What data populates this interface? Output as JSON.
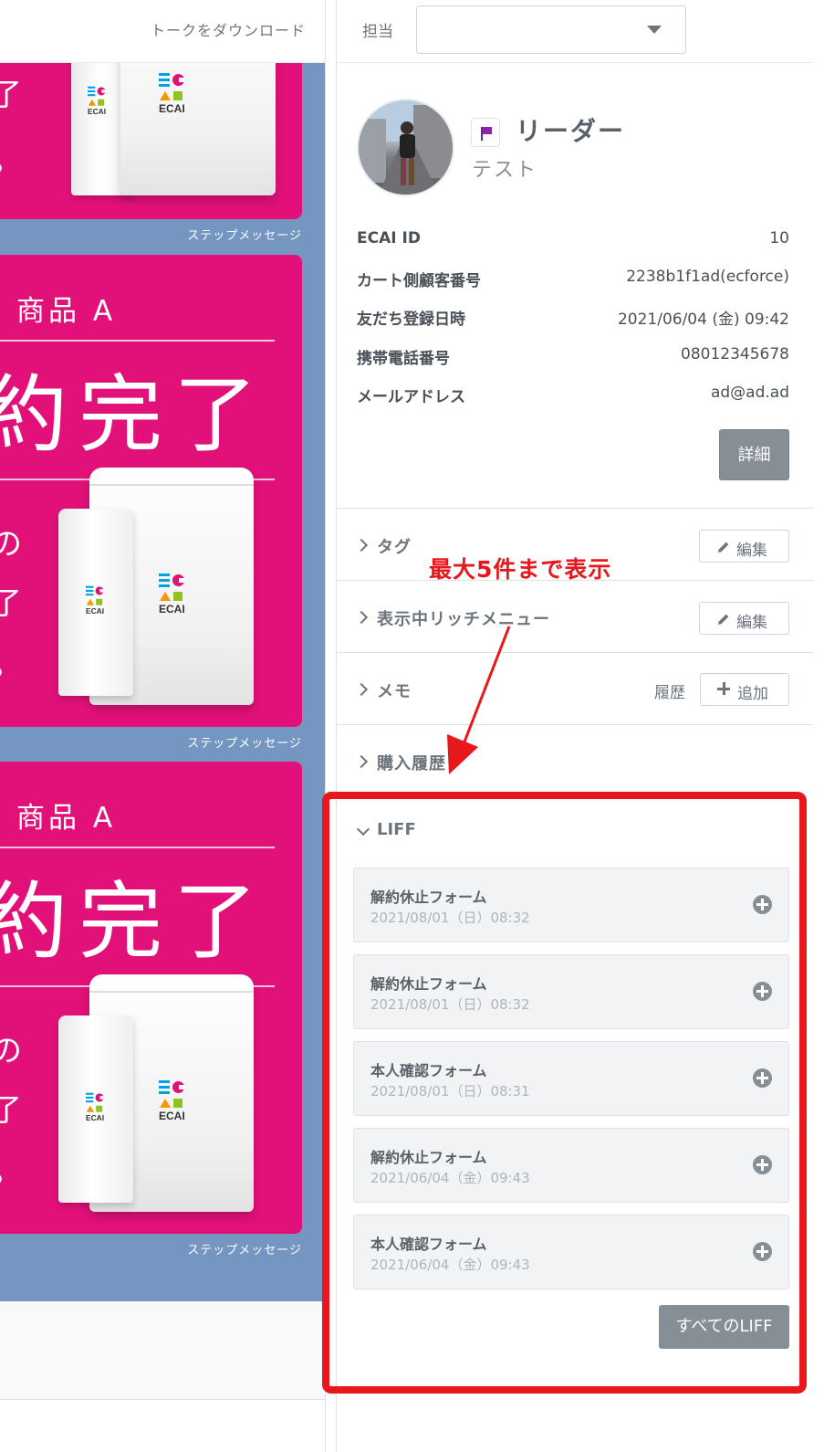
{
  "chat": {
    "download_label": "トークをダウンロード",
    "step_label": "ステップメッセージ",
    "product_label": "商品 A",
    "big_text": "約完了",
    "side_chars": [
      "了",
      "。",
      "の",
      "了",
      "。"
    ],
    "logo_text": "ECAI",
    "colors": {
      "bubble": "#e2117a",
      "background": "#7496c1"
    }
  },
  "header": {
    "tantou_label": "担当",
    "tantou_value": ""
  },
  "profile": {
    "name": "リーダー",
    "sub": "テスト",
    "flag_color": "#8e24aa",
    "fields": [
      {
        "label": "ECAI ID",
        "value": "10"
      },
      {
        "label": "カート側顧客番号",
        "value": "2238b1f1ad(ecforce)"
      },
      {
        "label": "友だち登録日時",
        "value": "2021/06/04 (金) 09:42"
      },
      {
        "label": "携帯電話番号",
        "value": "08012345678"
      },
      {
        "label": "メールアドレス",
        "value": "ad@ad.ad"
      }
    ],
    "detail_button": "詳細"
  },
  "sections": {
    "tag": {
      "title": "タグ",
      "button": "編集"
    },
    "richmenu": {
      "title": "表示中リッチメニュー",
      "button": "編集"
    },
    "memo": {
      "title": "メモ",
      "history": "履歴",
      "button": "追加"
    },
    "purchase": {
      "title": "購入履歴"
    }
  },
  "liff": {
    "title": "LIFF",
    "items": [
      {
        "name": "解約休止フォーム",
        "date": "2021/08/01（日）08:32"
      },
      {
        "name": "解約休止フォーム",
        "date": "2021/08/01（日）08:32"
      },
      {
        "name": "本人確認フォーム",
        "date": "2021/08/01（日）08:31"
      },
      {
        "name": "解約休止フォーム",
        "date": "2021/06/04（金）09:43"
      },
      {
        "name": "本人確認フォーム",
        "date": "2021/06/04（金）09:43"
      }
    ],
    "all_button": "すべてのLIFF"
  },
  "annotation": {
    "text": "最大5件まで表示",
    "color": "#e8171b"
  }
}
